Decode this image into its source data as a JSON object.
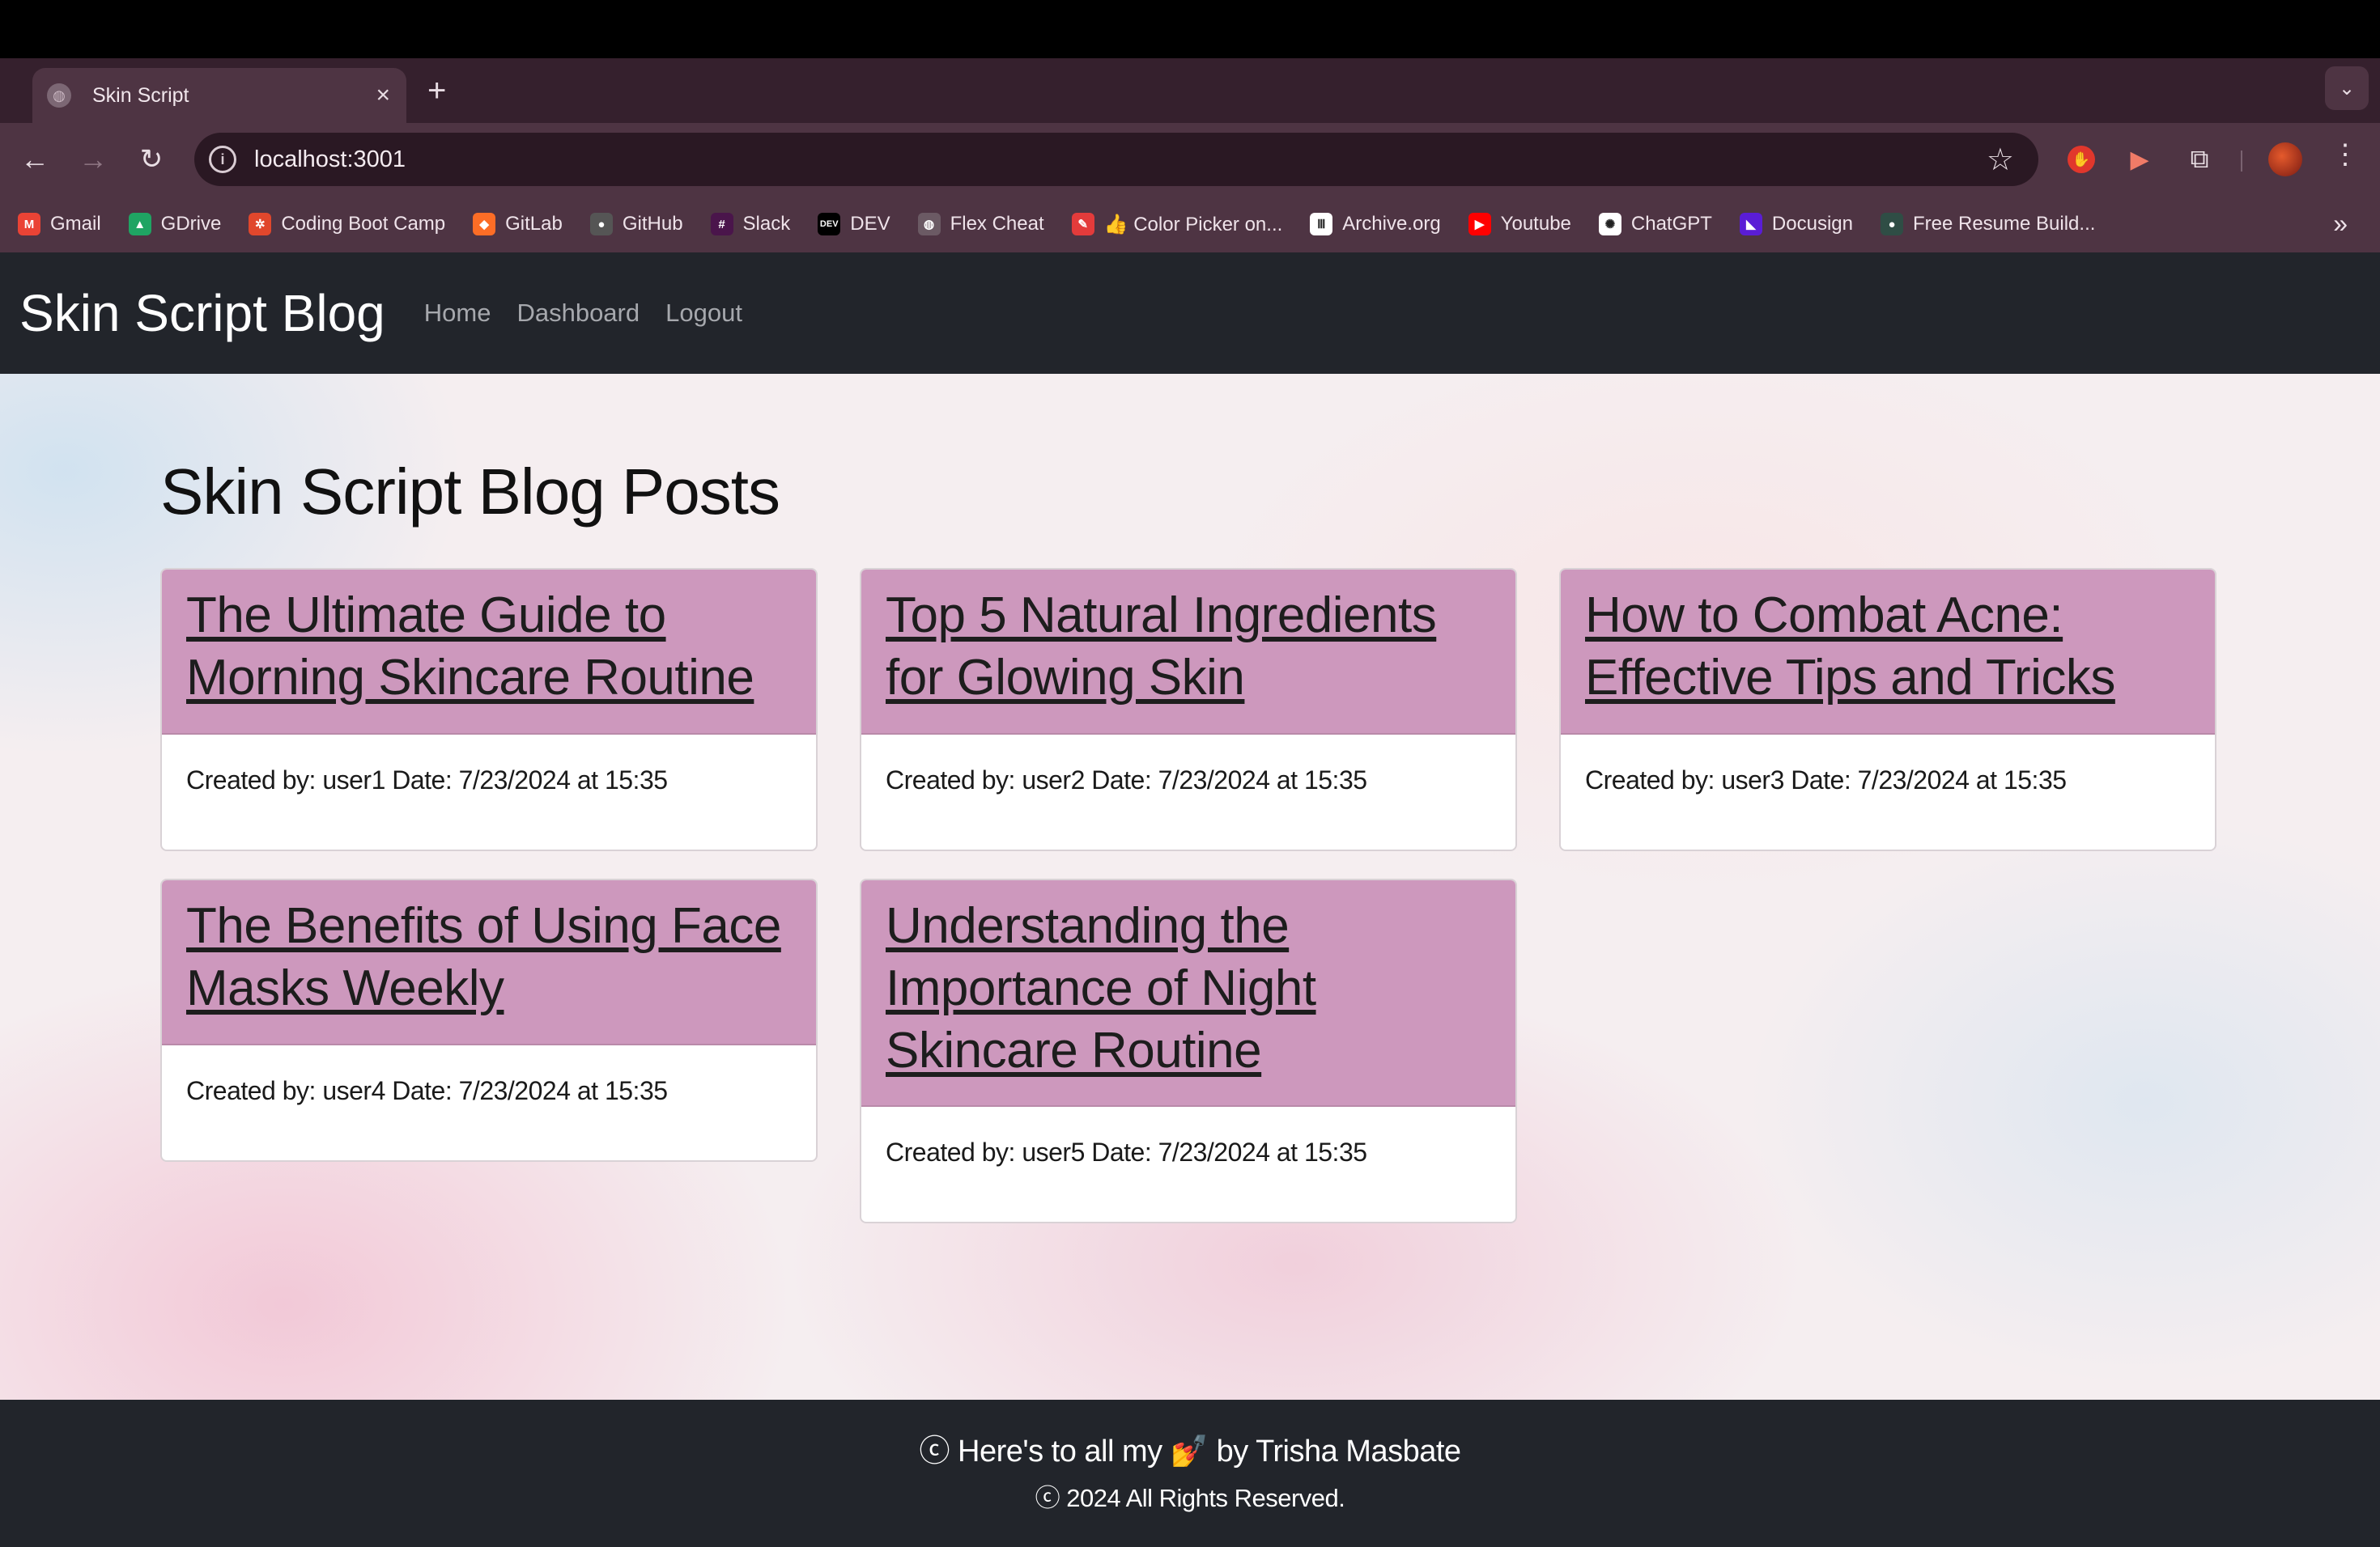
{
  "browser": {
    "tab": {
      "title": "Skin Script"
    },
    "address_bar": {
      "url": "localhost:3001"
    },
    "bookmarks": [
      {
        "label": "Gmail",
        "icon": "gmail-icon",
        "color": "#ea4335"
      },
      {
        "label": "GDrive",
        "icon": "gdrive-icon",
        "color": "#1fa463"
      },
      {
        "label": "Coding Boot Camp",
        "icon": "bootcamp-icon",
        "color": "#e0472c"
      },
      {
        "label": "GitLab",
        "icon": "gitlab-icon",
        "color": "#fc6d26"
      },
      {
        "label": "GitHub",
        "icon": "github-icon",
        "color": "#555555"
      },
      {
        "label": "Slack",
        "icon": "slack-icon",
        "color": "#4a154b"
      },
      {
        "label": "DEV",
        "icon": "dev-icon",
        "color": "#000000"
      },
      {
        "label": "Flex Cheat",
        "icon": "globe-icon",
        "color": "#6b5a64"
      },
      {
        "label": "👍 Color Picker on...",
        "icon": "color-picker-icon",
        "color": "#e33b3b"
      },
      {
        "label": "Archive.org",
        "icon": "archive-icon",
        "color": "#ffffff"
      },
      {
        "label": "Youtube",
        "icon": "youtube-icon",
        "color": "#ff0000"
      },
      {
        "label": "ChatGPT",
        "icon": "chatgpt-icon",
        "color": "#ffffff"
      },
      {
        "label": "Docusign",
        "icon": "docusign-icon",
        "color": "#5a1dd6"
      },
      {
        "label": "Free Resume Build...",
        "icon": "resume-icon",
        "color": "#2f4d45"
      }
    ]
  },
  "site": {
    "brand": "Skin Script Blog",
    "nav": [
      "Home",
      "Dashboard",
      "Logout"
    ],
    "page_title": "Skin Script Blog Posts",
    "posts": [
      {
        "title": "The Ultimate Guide to Morning Skincare Routine",
        "meta": "Created by: user1 Date: 7/23/2024 at 15:35"
      },
      {
        "title": "Top 5 Natural Ingredients for Glowing Skin",
        "meta": "Created by: user2 Date: 7/23/2024 at 15:35"
      },
      {
        "title": "How to Combat Acne: Effective Tips and Tricks",
        "meta": "Created by: user3 Date: 7/23/2024 at 15:35"
      },
      {
        "title": "The Benefits of Using Face Masks Weekly",
        "meta": "Created by: user4 Date: 7/23/2024 at 15:35"
      },
      {
        "title": "Understanding the Importance of Night Skincare Routine",
        "meta": "Created by: user5 Date: 7/23/2024 at 15:35"
      }
    ],
    "footer": {
      "line1": "ⓒ Here's to all my 💅 by Trisha Masbate",
      "line2": "ⓒ 2024 All Rights Reserved."
    },
    "colors": {
      "nav_bg": "#22252b",
      "card_header": "#cd98bd",
      "footer_bg": "#22252b"
    }
  }
}
